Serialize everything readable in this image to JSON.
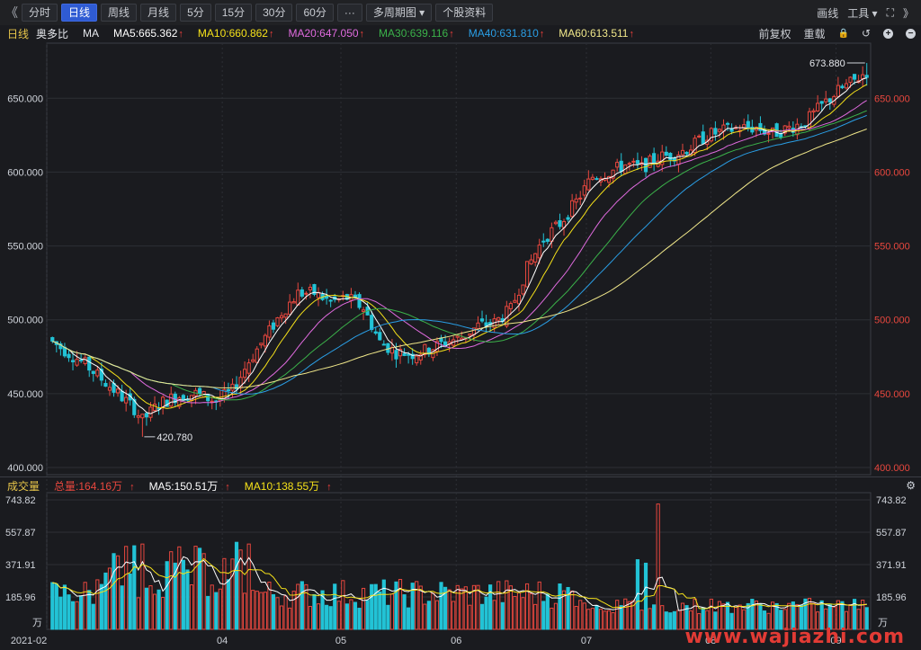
{
  "toolbar": {
    "collapse": "《",
    "expand": "》",
    "periods": [
      {
        "label": "分时",
        "active": false
      },
      {
        "label": "日线",
        "active": true
      },
      {
        "label": "周线",
        "active": false
      },
      {
        "label": "月线",
        "active": false
      },
      {
        "label": "5分",
        "active": false
      },
      {
        "label": "15分",
        "active": false
      },
      {
        "label": "30分",
        "active": false
      },
      {
        "label": "60分",
        "active": false
      }
    ],
    "more": "···",
    "multi_period": "多周期图 ▾",
    "stock_info": "个股资料",
    "draw": "画线",
    "tools": "工具 ▾",
    "fullscreen": "⛶"
  },
  "legend": {
    "period": "日线",
    "name": "奥多比",
    "ma_label": "MA",
    "ma5": "MA5:665.362",
    "ma10": "MA10:660.862",
    "ma20": "MA20:647.050",
    "ma30": "MA30:639.116",
    "ma40": "MA40:631.810",
    "ma60": "MA60:613.511",
    "up_arrow": "↑",
    "adjust": "前复权",
    "reload": "重载",
    "lock_icon": "🔒",
    "undo_icon": "↺",
    "zoom_in": "+",
    "zoom_out": "−"
  },
  "volume_legend": {
    "title": "成交量",
    "total": "总量:164.16万",
    "ma5": "MA5:150.51万",
    "ma10": "MA10:138.55万",
    "up_arrow": "↑"
  },
  "colors": {
    "up": "#e8473e",
    "down": "#22c3d6",
    "ma5": "#ffffff",
    "ma10": "#f5e11a",
    "ma20": "#e06bdf",
    "ma30": "#3bb24a",
    "ma40": "#2a9ee5",
    "ma60": "#f0e78a",
    "grid": "#2d2f35",
    "axis_text": "#cfd3da",
    "right_axis_text": "#e8473e"
  },
  "watermark": "www.wajiazhi.com",
  "chart_data": [
    {
      "type": "candlestick",
      "title": "",
      "ylim": [
        400,
        680
      ],
      "yticks": [
        "400.000",
        "450.000",
        "500.000",
        "550.000",
        "600.000",
        "650.000"
      ],
      "xticks": [
        "2021-02",
        "04",
        "05",
        "06",
        "07",
        "08",
        "09"
      ],
      "high_annotation": "673.880",
      "low_annotation": "420.780",
      "grid": true
    },
    {
      "type": "bar",
      "title": "成交量",
      "unit": "万",
      "ylim": [
        0,
        743.82
      ],
      "yticks": [
        "185.96",
        "371.91",
        "557.87",
        "743.82"
      ],
      "grid": true
    }
  ]
}
